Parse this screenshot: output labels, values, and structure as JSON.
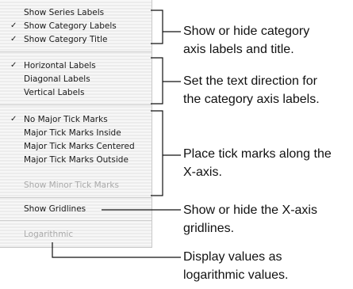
{
  "menu": {
    "groups": [
      {
        "items": [
          {
            "label": "Show Series Labels",
            "checked": false,
            "enabled": true
          },
          {
            "label": "Show Category Labels",
            "checked": true,
            "enabled": true
          },
          {
            "label": "Show Category Title",
            "checked": true,
            "enabled": true
          }
        ]
      },
      {
        "items": [
          {
            "label": "Horizontal Labels",
            "checked": true,
            "enabled": true
          },
          {
            "label": "Diagonal Labels",
            "checked": false,
            "enabled": true
          },
          {
            "label": "Vertical Labels",
            "checked": false,
            "enabled": true
          }
        ]
      },
      {
        "items": [
          {
            "label": "No Major Tick Marks",
            "checked": true,
            "enabled": true
          },
          {
            "label": "Major Tick Marks Inside",
            "checked": false,
            "enabled": true
          },
          {
            "label": "Major Tick Marks Centered",
            "checked": false,
            "enabled": true
          },
          {
            "label": "Major Tick Marks Outside",
            "checked": false,
            "enabled": true
          },
          {
            "label": "Show Minor Tick Marks",
            "checked": false,
            "enabled": false
          }
        ]
      },
      {
        "items": [
          {
            "label": "Show Gridlines",
            "checked": false,
            "enabled": true
          }
        ]
      },
      {
        "items": [
          {
            "label": "Logarithmic",
            "checked": false,
            "enabled": false
          }
        ]
      }
    ],
    "check_glyph": "✓"
  },
  "callouts": {
    "category_labels": {
      "line1": "Show or hide category",
      "line2": "axis labels and title."
    },
    "text_direction": {
      "line1": "Set the text direction for",
      "line2": "the category axis labels."
    },
    "tick_marks": {
      "line1": "Place tick marks along the",
      "line2": "X-axis."
    },
    "gridlines": {
      "line1": "Show or hide the X-axis",
      "line2": "gridlines."
    },
    "logarithmic": {
      "line1": "Display values as",
      "line2": "logarithmic values."
    }
  }
}
